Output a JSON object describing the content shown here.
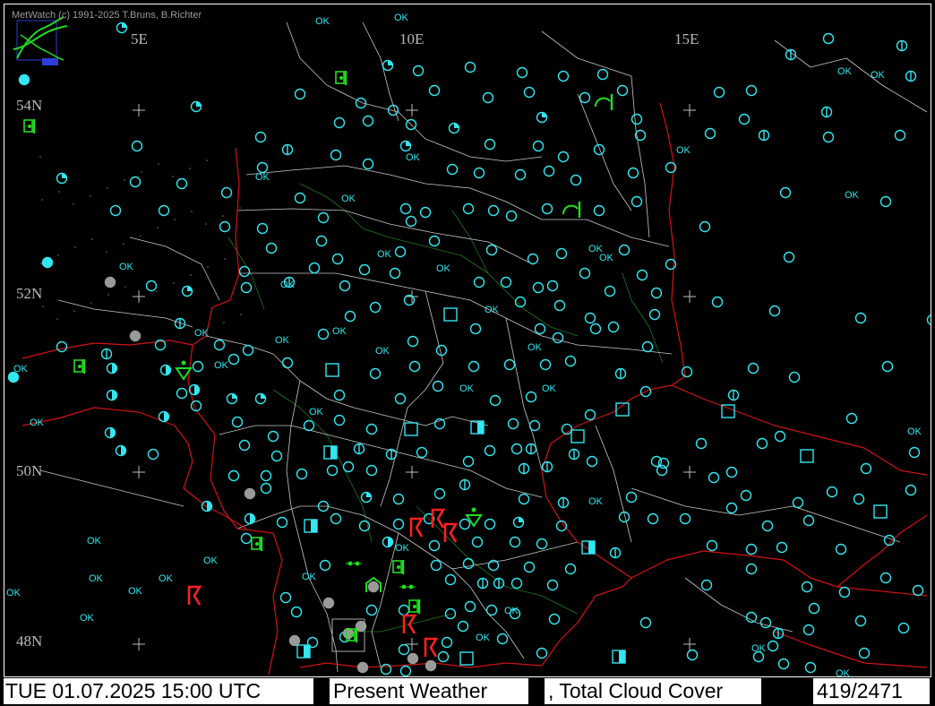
{
  "app": {
    "credit": "MetWatch  (c) 1991-2025 T.Bruns, B.Richter",
    "logo_label": "MetWatch logo"
  },
  "map": {
    "lat_labels": [
      "54N",
      "52N",
      "50N",
      "48N"
    ],
    "lon_labels": [
      "5E",
      "10E",
      "15E"
    ],
    "colors": {
      "background": "#000000",
      "station": "#33e6f0",
      "borders": "#d01414",
      "states": "#c8c8c8",
      "rivers": "#1f7a1f",
      "weather_green": "#22dd22",
      "weather_red": "#ff2020",
      "missing": "#9a9a9a"
    },
    "cloud_symbol_legend": [
      "clear",
      "quarter",
      "half",
      "three-quarter",
      "overcast",
      "obscured",
      "missing"
    ],
    "ok_label": "OK",
    "weather_symbols": [
      "thunderstorm",
      "shower",
      "rain",
      "drizzle",
      "fog"
    ]
  },
  "status": {
    "datetime": "TUE 01.07.2025 15:00 UTC",
    "product": "Present Weather",
    "product2": ", Total Cloud Cover",
    "count": "419/2471"
  }
}
